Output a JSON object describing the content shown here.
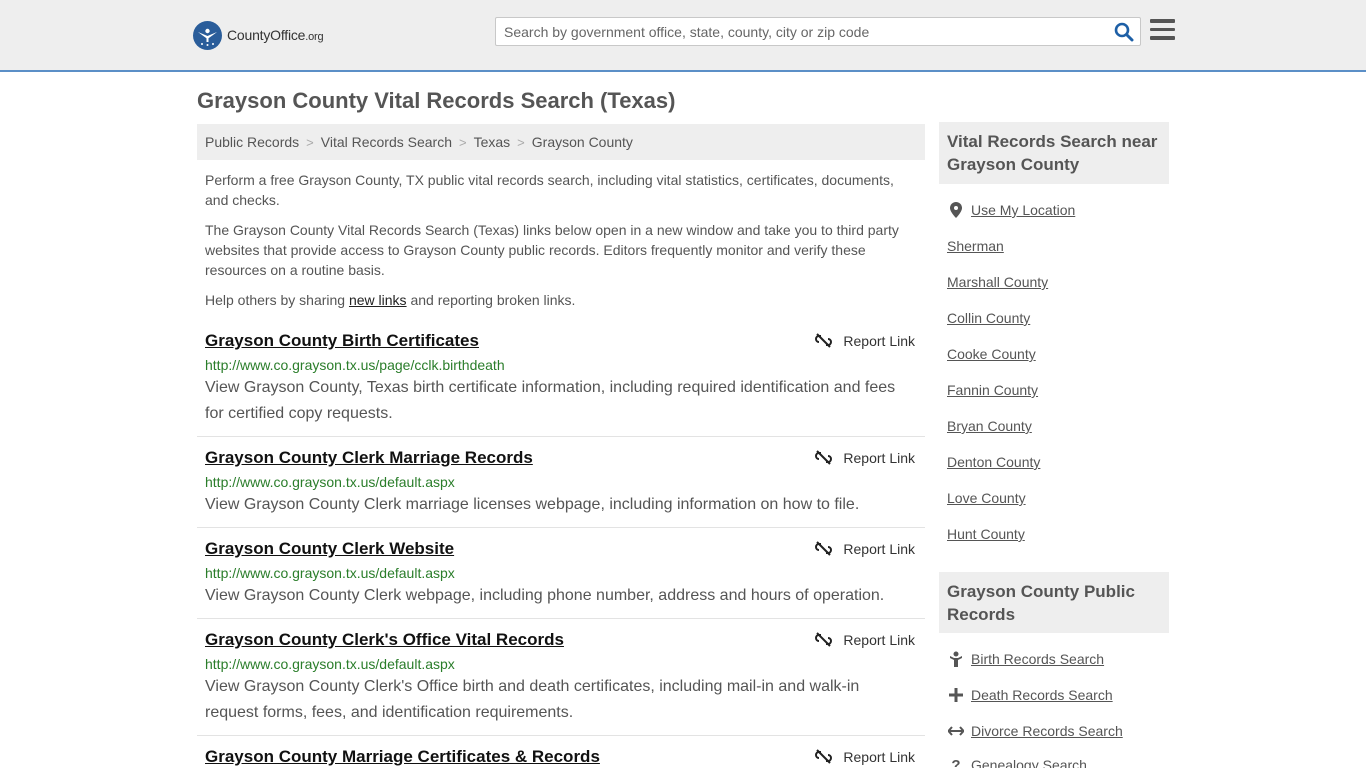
{
  "header": {
    "logo_main": "CountyOffice",
    "logo_tld": ".org",
    "search_placeholder": "Search by government office, state, county, city or zip code"
  },
  "page_title": "Grayson County Vital Records Search (Texas)",
  "breadcrumb": [
    "Public Records",
    "Vital Records Search",
    "Texas",
    "Grayson County"
  ],
  "intro": {
    "p1": "Perform a free Grayson County, TX public vital records search, including vital statistics, certificates, documents, and checks.",
    "p2": "The Grayson County Vital Records Search (Texas) links below open in a new window and take you to third party websites that provide access to Grayson County public records. Editors frequently monitor and verify these resources on a routine basis.",
    "p3_before": "Help others by sharing ",
    "p3_link": "new links",
    "p3_after": " and reporting broken links."
  },
  "report_label": "Report Link",
  "results": [
    {
      "title": "Grayson County Birth Certificates",
      "url": "http://www.co.grayson.tx.us/page/cclk.birthdeath",
      "desc": "View Grayson County, Texas birth certificate information, including required identification and fees for certified copy requests."
    },
    {
      "title": "Grayson County Clerk Marriage Records",
      "url": "http://www.co.grayson.tx.us/default.aspx",
      "desc": "View Grayson County Clerk marriage licenses webpage, including information on how to file."
    },
    {
      "title": "Grayson County Clerk Website",
      "url": "http://www.co.grayson.tx.us/default.aspx",
      "desc": "View Grayson County Clerk webpage, including phone number, address and hours of operation."
    },
    {
      "title": "Grayson County Clerk's Office Vital Records",
      "url": "http://www.co.grayson.tx.us/default.aspx",
      "desc": "View Grayson County Clerk's Office birth and death certificates, including mail-in and walk-in request forms, fees, and identification requirements."
    },
    {
      "title": "Grayson County Marriage Certificates & Records",
      "url": "",
      "desc": ""
    }
  ],
  "sidebar": {
    "nearby_heading": "Vital Records Search near Grayson County",
    "use_location": "Use My Location",
    "nearby": [
      "Sherman",
      "Marshall County",
      "Collin County",
      "Cooke County",
      "Fannin County",
      "Bryan County",
      "Denton County",
      "Love County",
      "Hunt County"
    ],
    "public_heading": "Grayson County Public Records",
    "public_links": [
      {
        "label": "Birth Records Search",
        "icon": "baby-icon"
      },
      {
        "label": "Death Records Search",
        "icon": "cross-icon"
      },
      {
        "label": "Divorce Records Search",
        "icon": "split-arrows-icon"
      },
      {
        "label": "Genealogy Search",
        "icon": "question-icon"
      }
    ]
  }
}
